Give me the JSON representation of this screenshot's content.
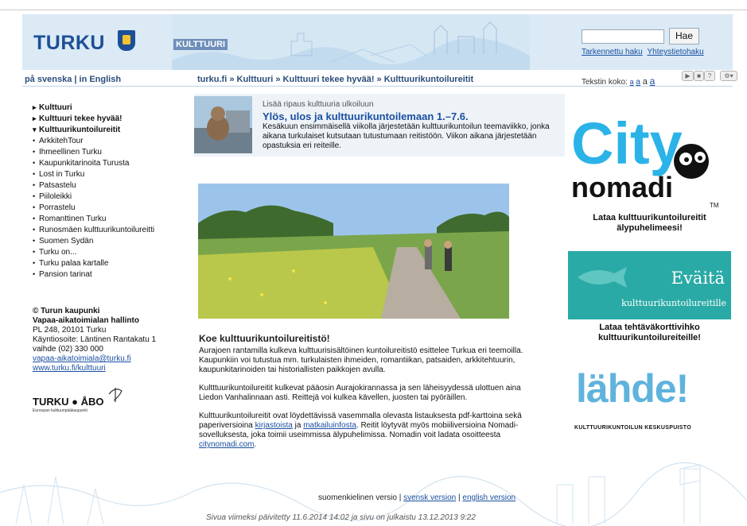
{
  "header": {
    "logo_text": "TURKU",
    "banner_label": "KULTTUURI",
    "search": {
      "placeholder": "",
      "button_label": "Hae"
    },
    "advanced_search_link": "Tarkennettu haku",
    "contact_search_link": "Yhteystietohaku"
  },
  "navbar": {
    "lang_links": "på svenska | in English",
    "breadcrumb": "turku.fi » Kulttuuri » Kulttuuri tekee hyvää! » Kulttuurikuntoilureitit",
    "text_size_label": "Tekstin koko:",
    "text_size_options": [
      "a",
      "a",
      "a",
      "a"
    ]
  },
  "sidebar": {
    "items": [
      {
        "label": "Kulttuuri",
        "bullet": "▸",
        "bold": true
      },
      {
        "label": "Kulttuuri tekee hyvää!",
        "bullet": "▸",
        "bold": true
      },
      {
        "label": "Kulttuurikuntoilureitit",
        "bullet": "▾",
        "bold": true
      },
      {
        "label": "ArkkitehTour",
        "bullet": "•",
        "bold": false
      },
      {
        "label": "Ihmeellinen Turku",
        "bullet": "•",
        "bold": false
      },
      {
        "label": "Kaupunkitarinoita Turusta",
        "bullet": "•",
        "bold": false
      },
      {
        "label": "Lost in Turku",
        "bullet": "•",
        "bold": false
      },
      {
        "label": "Patsastelu",
        "bullet": "•",
        "bold": false
      },
      {
        "label": "Piiloleikki",
        "bullet": "•",
        "bold": false
      },
      {
        "label": "Porrastelu",
        "bullet": "•",
        "bold": false
      },
      {
        "label": "Romanttinen Turku",
        "bullet": "•",
        "bold": false
      },
      {
        "label": "Runosmäen kulttuurikuntoilureitti",
        "bullet": "•",
        "bold": false
      },
      {
        "label": "Suomen Sydän",
        "bullet": "•",
        "bold": false
      },
      {
        "label": "Turku on...",
        "bullet": "•",
        "bold": false
      },
      {
        "label": "Turku palaa kartalle",
        "bullet": "•",
        "bold": false
      },
      {
        "label": "Pansion tarinat",
        "bullet": "•",
        "bold": false
      }
    ]
  },
  "contact": {
    "copyright": "© Turun kaupunki",
    "org": "Vapaa-aikatoimialan hallinto",
    "address": "PL 248, 20101 Turku",
    "visit": "Käyntiosoite: Läntinen Rantakatu 1",
    "phone": "vaihde (02) 330 000",
    "email": "vapaa-aikatoimiala@turku.fi",
    "web": "www.turku.fi/kulttuuri",
    "logo_text": "TURKU ● ÅBO",
    "logo_sub": "Euroopan kulttuuripääkaupunki"
  },
  "promo": {
    "subtitle": "Lisää ripaus kulttuuria ulkoiluun",
    "title": "Ylös, ulos ja kulttuurikuntoilemaan 1.–7.6.",
    "text": "Kesäkuun ensimmäisellä viikolla järjestetään kulttuurikuntoilun teemaviikko, jonka aikana turkulaiset kutsutaan tutustumaan reitistöön. Viikon aikana järjestetään opastuksia eri reiteille."
  },
  "article": {
    "heading": "Koe kulttuurikuntoilureitistö!",
    "p1": "Aurajoen rantamilla kulkeva kulttuurisisältöinen kuntoilureitistö esittelee Turkua eri teemoilla. Kaupunkiin voi tutustua mm. turkulaisten ihmeiden, romantiikan, patsaiden, arkkitehtuurin, kaupunkitarinoiden tai historiallisten paikkojen avulla.",
    "p2": "Kultttuurikuntoilureitit kulkevat pääosin Aurajokirannassa ja sen läheisyydessä ulottuen aina Liedon Vanhalinnaan asti. Reittejä voi kulkea kävellen, juosten tai pyöräillen.",
    "p3_a": "Kulttuurikuntoilureitit ovat löydettävissä vasemmalla olevasta listauksesta pdf-karttoina sekä paperiversioina ",
    "p3_link1": "kirjastoista",
    "p3_b": " ja ",
    "p3_link2": "matkailuinfosta",
    "p3_c": ". Reitit löytyvät myös mobiiliversioina Nomadi-sovelluksesta, joka toimii useimmissa älypuhelimissa. Nomadin voit ladata osoitteesta ",
    "p3_link3": "citynomadi.com",
    "p3_d": "."
  },
  "footer": {
    "version_fi": "suomenkielinen versio",
    "version_sv": "svensk version",
    "version_en": "english version",
    "updated": "Sivua viimeksi päivitetty 11.6.2014 14:02 ja sivu on julkaistu 13.12.2013 9:22"
  },
  "ads": {
    "citynomadi": {
      "logo_top": "City",
      "logo_bottom": "nomadi",
      "tm": "TM",
      "caption": "Lataa kulttuurikuntoilureitit älypuhelimeesi!"
    },
    "evaita": {
      "title": "Eväitä",
      "subtitle": "kulttuurikuntoilureitille",
      "caption": "Lataa tehtäväkorttivihko kulttuurikuntoilureiteille!"
    },
    "lahde": {
      "word": "lähde!",
      "subtitle": "KULTTUURIKUNTOILUN KESKUSPUISTO"
    }
  },
  "colors": {
    "header_bg": "#dbeaf5",
    "link": "#1a4fa0",
    "evaita_bg": "#2aaaa6",
    "citynomadi": "#2bb3e8"
  }
}
